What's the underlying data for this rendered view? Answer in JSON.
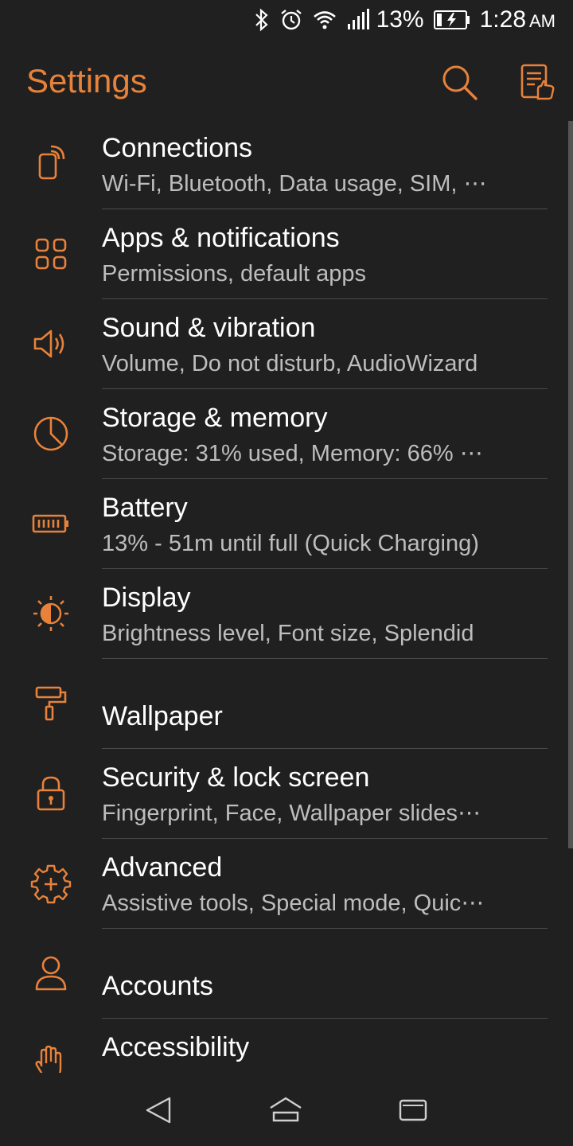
{
  "status_bar": {
    "battery_percent": "13%",
    "time": "1:28",
    "ampm": "AM",
    "icons": [
      "bluetooth-icon",
      "alarm-icon",
      "wifi-icon",
      "signal-icon",
      "battery-charging-icon"
    ]
  },
  "header": {
    "title": "Settings",
    "search_icon": "search-icon",
    "tips_icon": "tips-icon"
  },
  "accent_color": "#e8823a",
  "settings": {
    "items": [
      {
        "title": "Connections",
        "subtitle": "Wi-Fi, Bluetooth, Data usage, SIM, ⋯",
        "icon": "connections-icon"
      },
      {
        "title": "Apps & notifications",
        "subtitle": "Permissions, default apps",
        "icon": "apps-icon"
      },
      {
        "title": "Sound & vibration",
        "subtitle": "Volume, Do not disturb, AudioWizard",
        "icon": "sound-icon"
      },
      {
        "title": "Storage & memory",
        "subtitle": "Storage: 31% used, Memory: 66% ⋯",
        "icon": "storage-icon"
      },
      {
        "title": "Battery",
        "subtitle": "13% - 51m until full (Quick Charging)",
        "icon": "battery-icon"
      },
      {
        "title": "Display",
        "subtitle": "Brightness level, Font size, Splendid",
        "icon": "display-icon"
      },
      {
        "title": "Wallpaper",
        "subtitle": "",
        "icon": "wallpaper-icon"
      },
      {
        "title": "Security & lock screen",
        "subtitle": "Fingerprint, Face, Wallpaper slides⋯",
        "icon": "lock-icon"
      },
      {
        "title": "Advanced",
        "subtitle": "Assistive tools, Special mode, Quic⋯",
        "icon": "advanced-icon"
      },
      {
        "title": "Accounts",
        "subtitle": "",
        "icon": "accounts-icon"
      },
      {
        "title": "Accessibility",
        "subtitle": "",
        "icon": "accessibility-icon"
      }
    ]
  },
  "nav_bar": {
    "buttons": [
      "back-icon",
      "home-icon",
      "recents-icon"
    ]
  }
}
